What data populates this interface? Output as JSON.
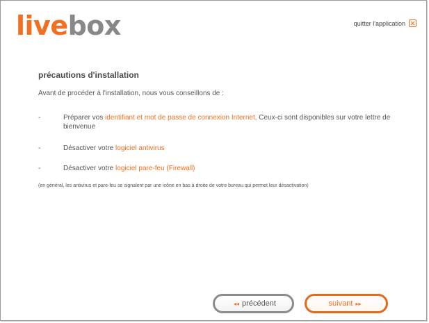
{
  "brand": {
    "part1": "live",
    "part2": "box"
  },
  "header": {
    "quit_label": "quitter l'application"
  },
  "main": {
    "title": "précautions d'installation",
    "intro": "Avant de procéder à l'installation, nous vous conseillons de :",
    "items": [
      {
        "dash": "-",
        "prefix": "Préparer vos ",
        "highlight": "identifiant et mot de passe de connexion Internet",
        "suffix": ". Ceux-ci sont disponibles sur votre lettre de bienvenue"
      },
      {
        "dash": "-",
        "prefix": "Désactiver votre ",
        "highlight": "logiciel antivirus",
        "suffix": ""
      },
      {
        "dash": "-",
        "prefix": "Désactiver votre ",
        "highlight": "logiciel pare-feu (Firewall)",
        "suffix": ""
      }
    ],
    "note": "(en général, les antivirus et pare-feu se signalent par une icône en bas à droite de votre bureau qui permet leur désactivation)"
  },
  "footer": {
    "prev_label": "précédent",
    "next_label": "suivant",
    "prev_arrow": "◂◂",
    "next_arrow": "▸▸"
  },
  "colors": {
    "accent": "#f26f21",
    "gray_text": "#888888"
  }
}
